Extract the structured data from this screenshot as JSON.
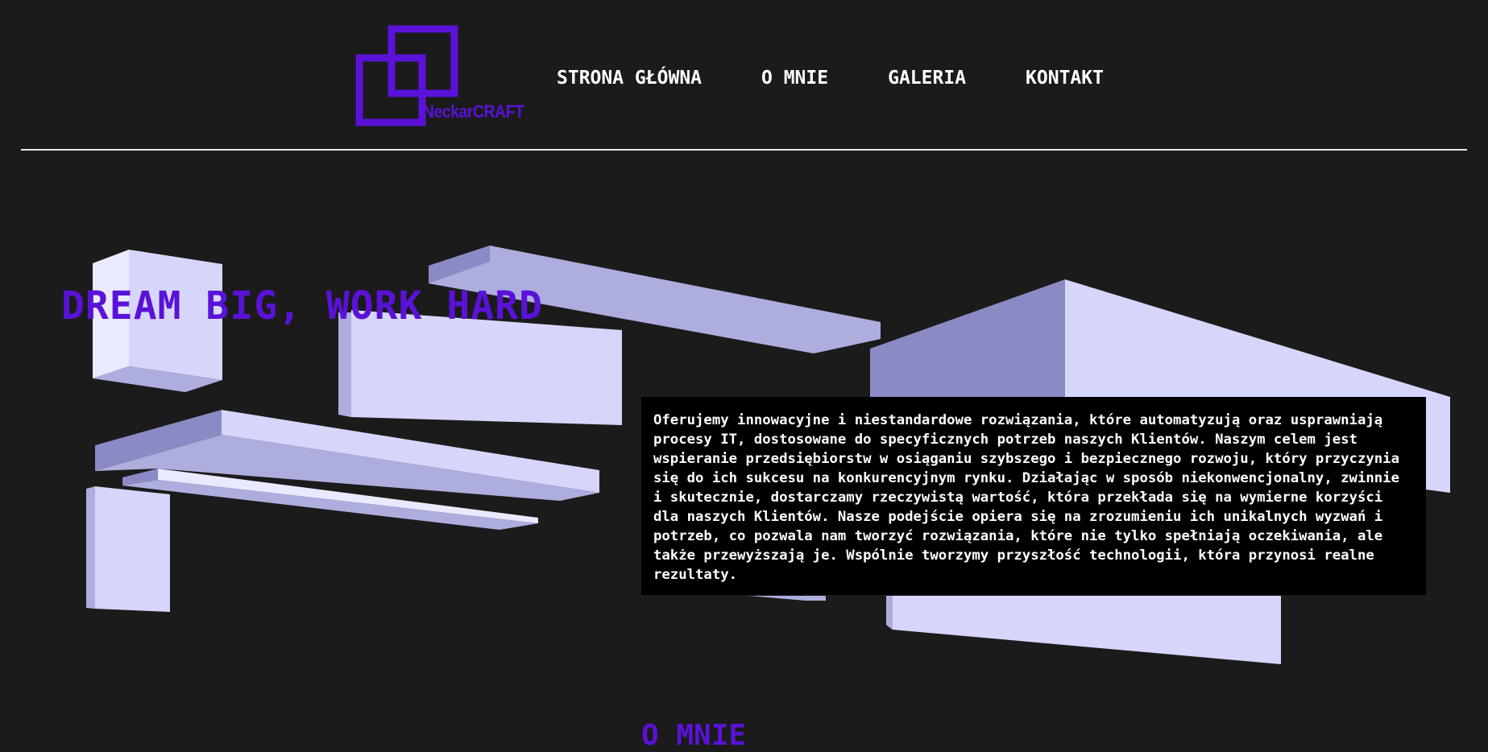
{
  "brand": {
    "name": "NeckarCRAFT",
    "color": "#5a12d8"
  },
  "nav": {
    "items": [
      "STRONA GŁÓWNA",
      "O MNIE",
      "GALERIA",
      "KONTAKT"
    ]
  },
  "hero": {
    "title": "DREAM BIG, WORK HARD",
    "description": "Oferujemy innowacyjne i niestandardowe rozwiązania, które automatyzują oraz usprawniają procesy IT, dostosowane do specyficznych potrzeb naszych Klientów. Naszym celem jest wspieranie przedsiębiorstw w osiąganiu szybszego i bezpiecznego rozwoju, który przyczynia się do ich sukcesu na konkurencyjnym rynku. Działając w sposób niekonwencjonalny, zwinnie i skutecznie, dostarczamy rzeczywistą wartość, która przekłada się na wymierne korzyści dla naszych Klientów. Nasze podejście opiera się na zrozumieniu ich unikalnych wyzwań i potrzeb, co pozwala nam tworzyć rozwiązania, które nie tylko spełniają oczekiwania, ale także przewyższają je. Wspólnie tworzymy przyszłość technologii, która przynosi realne rezultaty."
  },
  "about": {
    "title": "O MNIE"
  },
  "colors": {
    "background": "#1b1b1b",
    "accent": "#5a12d8",
    "shape_light": "#d6d6fb",
    "shape_mid": "#adadde",
    "shape_dark": "#8a8ac4"
  }
}
